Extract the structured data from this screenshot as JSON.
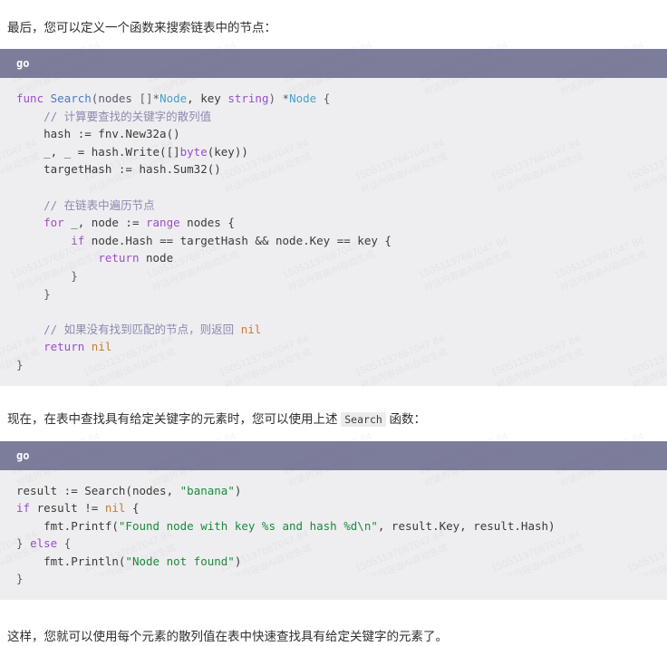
{
  "page": {
    "background": "#ffffff",
    "intro_paragraph": "最后，您可以定义一个函数来搜索链表中的节点：",
    "middle_paragraph_before_code": "现在，在表中查找具有给定关键字的元素时，您可以使用上述 ",
    "middle_paragraph_inline_code": "Search",
    "middle_paragraph_after_code": " 函数：",
    "closing_paragraph": "这样，您就可以使用每个元素的散列值在表中快速查找具有给定关键字的元素了。"
  },
  "colors": {
    "code_header_bg": "#7c7c9b",
    "code_body_bg": "#eeeef0",
    "keyword": "#9b4dca",
    "function": "#4a78c8",
    "type": "#4a9fc8",
    "comment": "#8a8ab0",
    "string": "#1a8a3c",
    "nil": "#c77b33",
    "text": "#2f2f2f"
  },
  "code_blocks": [
    {
      "language_label": "go",
      "lines": [
        [
          {
            "t": "func ",
            "c": "kw"
          },
          {
            "t": "Search",
            "c": "fn"
          },
          {
            "t": "(nodes []*",
            "c": "punc"
          },
          {
            "t": "Node",
            "c": "type"
          },
          {
            "t": ", key ",
            "c": "plain"
          },
          {
            "t": "string",
            "c": "kw"
          },
          {
            "t": ") *",
            "c": "punc"
          },
          {
            "t": "Node",
            "c": "type"
          },
          {
            "t": " {",
            "c": "punc"
          }
        ],
        [
          {
            "t": "    // 计算要查找的关键字的散列值",
            "c": "cmt"
          }
        ],
        [
          {
            "t": "    hash := fnv.New32a()",
            "c": "plain"
          }
        ],
        [
          {
            "t": "    _, _ = hash.Write([]",
            "c": "plain"
          },
          {
            "t": "byte",
            "c": "kw"
          },
          {
            "t": "(key))",
            "c": "plain"
          }
        ],
        [
          {
            "t": "    targetHash := hash.Sum32()",
            "c": "plain"
          }
        ],
        [
          {
            "t": "",
            "c": "plain"
          }
        ],
        [
          {
            "t": "    // 在链表中遍历节点",
            "c": "cmt"
          }
        ],
        [
          {
            "t": "    ",
            "c": "plain"
          },
          {
            "t": "for",
            "c": "kw"
          },
          {
            "t": " _, node := ",
            "c": "plain"
          },
          {
            "t": "range",
            "c": "kw"
          },
          {
            "t": " nodes {",
            "c": "plain"
          }
        ],
        [
          {
            "t": "        ",
            "c": "plain"
          },
          {
            "t": "if",
            "c": "kw"
          },
          {
            "t": " node.Hash == targetHash && node.Key == key {",
            "c": "plain"
          }
        ],
        [
          {
            "t": "            ",
            "c": "plain"
          },
          {
            "t": "return",
            "c": "kw"
          },
          {
            "t": " node",
            "c": "plain"
          }
        ],
        [
          {
            "t": "        }",
            "c": "punc"
          }
        ],
        [
          {
            "t": "    }",
            "c": "punc"
          }
        ],
        [
          {
            "t": "",
            "c": "plain"
          }
        ],
        [
          {
            "t": "    // 如果没有找到匹配的节点，则返回 ",
            "c": "cmt"
          },
          {
            "t": "nil",
            "c": "nil"
          }
        ],
        [
          {
            "t": "    ",
            "c": "plain"
          },
          {
            "t": "return",
            "c": "kw"
          },
          {
            "t": " ",
            "c": "plain"
          },
          {
            "t": "nil",
            "c": "nil"
          }
        ],
        [
          {
            "t": "}",
            "c": "punc"
          }
        ]
      ]
    },
    {
      "language_label": "go",
      "lines": [
        [
          {
            "t": "result := ",
            "c": "plain"
          },
          {
            "t": "Search",
            "c": "plain"
          },
          {
            "t": "(nodes, ",
            "c": "plain"
          },
          {
            "t": "\"banana\"",
            "c": "str"
          },
          {
            "t": ")",
            "c": "plain"
          }
        ],
        [
          {
            "t": "if",
            "c": "kw"
          },
          {
            "t": " result != ",
            "c": "plain"
          },
          {
            "t": "nil",
            "c": "nil"
          },
          {
            "t": " {",
            "c": "plain"
          }
        ],
        [
          {
            "t": "    fmt.Printf(",
            "c": "plain"
          },
          {
            "t": "\"Found node with key %s and hash %d\\n\"",
            "c": "str"
          },
          {
            "t": ", result.Key, result.Hash)",
            "c": "plain"
          }
        ],
        [
          {
            "t": "} ",
            "c": "punc"
          },
          {
            "t": "else",
            "c": "kw"
          },
          {
            "t": " {",
            "c": "punc"
          }
        ],
        [
          {
            "t": "    fmt.Println(",
            "c": "plain"
          },
          {
            "t": "\"Node not found\"",
            "c": "str"
          },
          {
            "t": ")",
            "c": "plain"
          }
        ],
        [
          {
            "t": "}",
            "c": "punc"
          }
        ]
      ]
    }
  ],
  "watermark": {
    "line1": "15051137667047 84",
    "line2": "对话内容由AI自动生成"
  }
}
